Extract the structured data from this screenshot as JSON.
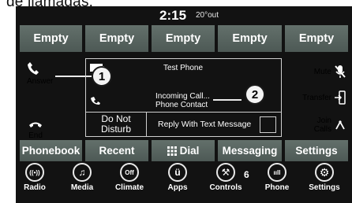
{
  "caption": "de llamadas:",
  "status": {
    "time": "2:15",
    "temperature": "20°out"
  },
  "favorites": [
    "Empty",
    "Empty",
    "Empty",
    "Empty",
    "Empty"
  ],
  "left_actions": {
    "answer": "Answer",
    "end": "End"
  },
  "right_actions": {
    "mute": "Mute",
    "transfer": "Transfer",
    "join_calls_line1": "Join",
    "join_calls_line2": "Calls"
  },
  "call_panel": {
    "phone_name": "Test Phone",
    "incoming_line1": "Incoming Call...",
    "incoming_line2": "Phone Contact",
    "do_not_disturb_line1": "Do Not",
    "do_not_disturb_line2": "Disturb",
    "reply_text": "Reply With Text Message"
  },
  "callouts": [
    "1",
    "2"
  ],
  "bottom_tabs": [
    "Phonebook",
    "Recent",
    "Dial",
    "Messaging",
    "Settings"
  ],
  "dock": [
    {
      "label": "Radio",
      "icon": "radio-icon",
      "glyph": "((•))"
    },
    {
      "label": "Media",
      "icon": "music-note-icon",
      "glyph": "♫"
    },
    {
      "label": "Climate",
      "icon": "climate-off-icon",
      "glyph": "Off"
    },
    {
      "label": "Apps",
      "icon": "apps-icon",
      "glyph": "ü"
    },
    {
      "label": "Controls",
      "icon": "wrench-icon",
      "glyph": "⚒"
    },
    {
      "label": "Phone",
      "icon": "phone-signal-icon",
      "glyph": "ııll"
    },
    {
      "label": "Settings",
      "icon": "gear-icon",
      "glyph": "⚙"
    }
  ],
  "dock_prefix": "6",
  "colors": {
    "button_top": "#63706b",
    "button_bottom": "#4d5955",
    "background": "#121212",
    "text": "#ffffff"
  }
}
